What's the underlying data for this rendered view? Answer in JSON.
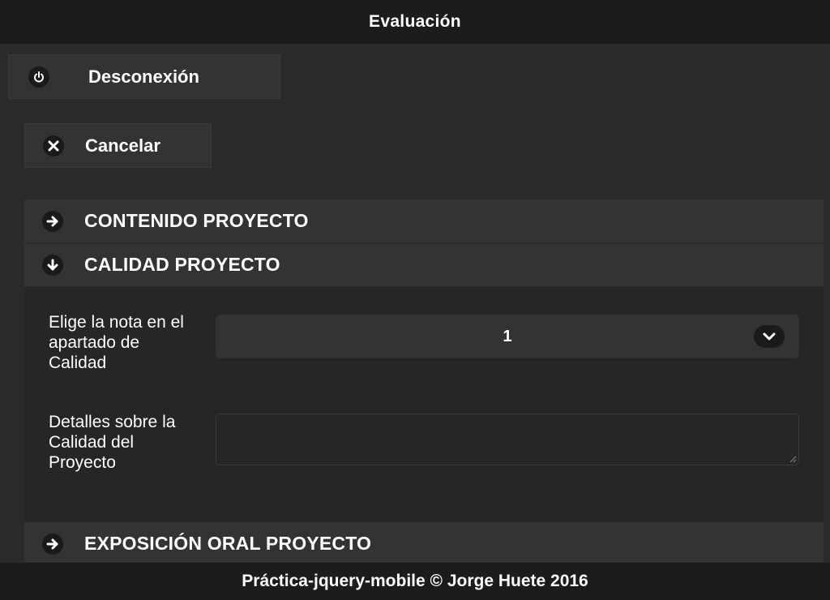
{
  "header": {
    "title": "Evaluación"
  },
  "toolbar": {
    "logout_label": "Desconexión",
    "logout_icon": "power-icon",
    "cancel_label": "Cancelar",
    "cancel_icon": "close-icon"
  },
  "sections": [
    {
      "label": "CONTENIDO PROYECTO",
      "icon": "arrow-right-icon",
      "expanded": false
    },
    {
      "label": "CALIDAD PROYECTO",
      "icon": "arrow-down-icon",
      "expanded": true
    },
    {
      "label": "EXPOSICIÓN ORAL PROYECTO",
      "icon": "arrow-right-icon",
      "expanded": false
    }
  ],
  "calidad": {
    "nota_label": "Elige la nota en el apartado de Calidad",
    "nota_value": "1",
    "detalles_label": "Detalles sobre la Calidad del Proyecto",
    "detalles_value": ""
  },
  "footer": {
    "text": "Práctica-jquery-mobile © Jorge Huete 2016"
  },
  "colors": {
    "header_bg": "#1c1c1c",
    "page_bg": "#2a2a2a",
    "button_bg": "#333333",
    "text": "#ffffff"
  }
}
